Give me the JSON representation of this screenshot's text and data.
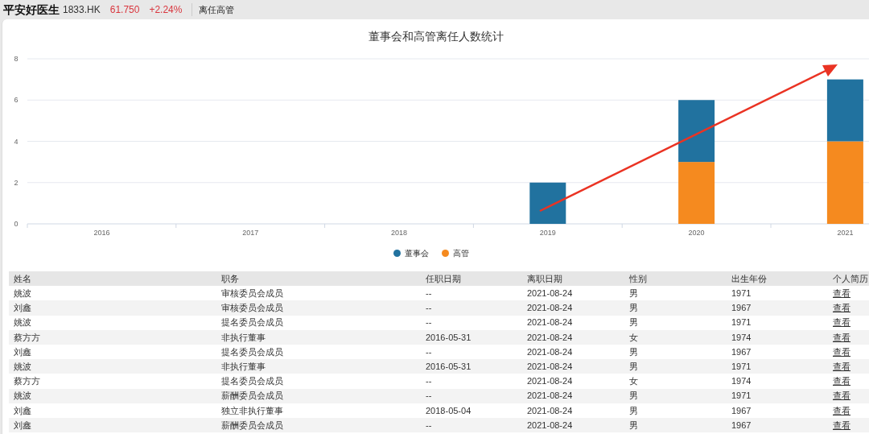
{
  "header": {
    "stock_name": "平安好医生",
    "code": "1833.HK",
    "price": "61.750",
    "change": "+2.24%",
    "page": "离任高管"
  },
  "chart": {
    "chart_data": {
      "type": "bar",
      "title": "董事会和高管离任人数统计",
      "categories": [
        "2016",
        "2017",
        "2018",
        "2019",
        "2020",
        "2021"
      ],
      "stacked": true,
      "grid": true,
      "ylim": [
        0,
        8
      ],
      "yticks": [
        0,
        2,
        4,
        6,
        8
      ],
      "series": [
        {
          "name": "董事会",
          "color": "#21729f",
          "values": [
            0,
            0,
            0,
            2,
            3,
            3
          ]
        },
        {
          "name": "高管",
          "color": "#f58a1f",
          "values": [
            0,
            0,
            0,
            0,
            3,
            4
          ]
        }
      ]
    }
  },
  "table": {
    "columns": [
      "姓名",
      "职务",
      "任职日期",
      "离职日期",
      "性别",
      "出生年份",
      "个人简历"
    ],
    "rows": [
      [
        "姚波",
        "审核委员会成员",
        "--",
        "2021-08-24",
        "男",
        "1971",
        "查看"
      ],
      [
        "刘鑫",
        "审核委员会成员",
        "--",
        "2021-08-24",
        "男",
        "1967",
        "查看"
      ],
      [
        "姚波",
        "提名委员会成员",
        "--",
        "2021-08-24",
        "男",
        "1971",
        "查看"
      ],
      [
        "蔡方方",
        "非执行董事",
        "2016-05-31",
        "2021-08-24",
        "女",
        "1974",
        "查看"
      ],
      [
        "刘鑫",
        "提名委员会成员",
        "--",
        "2021-08-24",
        "男",
        "1967",
        "查看"
      ],
      [
        "姚波",
        "非执行董事",
        "2016-05-31",
        "2021-08-24",
        "男",
        "1971",
        "查看"
      ],
      [
        "蔡方方",
        "提名委员会成员",
        "--",
        "2021-08-24",
        "女",
        "1974",
        "查看"
      ],
      [
        "姚波",
        "薪酬委员会成员",
        "--",
        "2021-08-24",
        "男",
        "1971",
        "查看"
      ],
      [
        "刘鑫",
        "独立非执行董事",
        "2018-05-04",
        "2021-08-24",
        "男",
        "1967",
        "查看"
      ],
      [
        "刘鑫",
        "薪酬委员会成员",
        "--",
        "2021-08-24",
        "男",
        "1967",
        "查看"
      ]
    ]
  }
}
